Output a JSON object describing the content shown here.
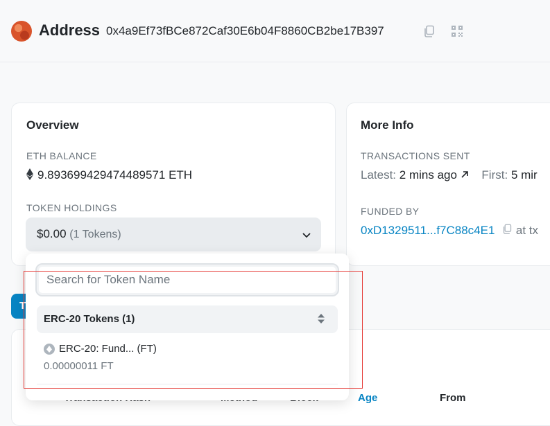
{
  "header": {
    "title": "Address",
    "address": "0x4a9Ef73fBCe872Caf30E6b04F8860CB2be17B397"
  },
  "overview": {
    "title": "Overview",
    "eth_balance_label": "ETH BALANCE",
    "eth_balance_value": "9.893699429474489571 ETH",
    "token_holdings_label": "TOKEN HOLDINGS",
    "token_holdings_amount": "$0.00",
    "token_holdings_count": "(1 Tokens)"
  },
  "more_info": {
    "title": "More Info",
    "tx_sent_label": "TRANSACTIONS SENT",
    "latest_label": "Latest:",
    "latest_value": "2 mins ago",
    "first_label": "First:",
    "first_value": "5 mir",
    "funded_by_label": "FUNDED BY",
    "funded_by_address": "0xD1329511...f7C88c4E1",
    "funded_by_suffix": "at tx"
  },
  "tabs": {
    "first_tab_letter": "T"
  },
  "table_headers": {
    "txn_hash": "Transaction Hash",
    "method": "Method",
    "block": "Block",
    "age": "Age",
    "from": "From"
  },
  "dropdown": {
    "search_placeholder": "Search for Token Name",
    "search_value": "",
    "group_label": "ERC-20 Tokens (1)",
    "items": [
      {
        "name": "ERC-20: Fund... (FT)",
        "amount": "0.00000011 FT"
      }
    ]
  },
  "colors": {
    "accent": "#0784c3",
    "highlight_box": "#e53935",
    "avatar": "#d9542b"
  },
  "icons": {
    "copy": "copy-icon",
    "qr": "qr-code-icon",
    "eth": "ethereum-icon",
    "chevron": "chevron-down-icon",
    "arrow": "arrow-up-right-icon",
    "sort": "sort-icon",
    "token": "token-icon"
  }
}
